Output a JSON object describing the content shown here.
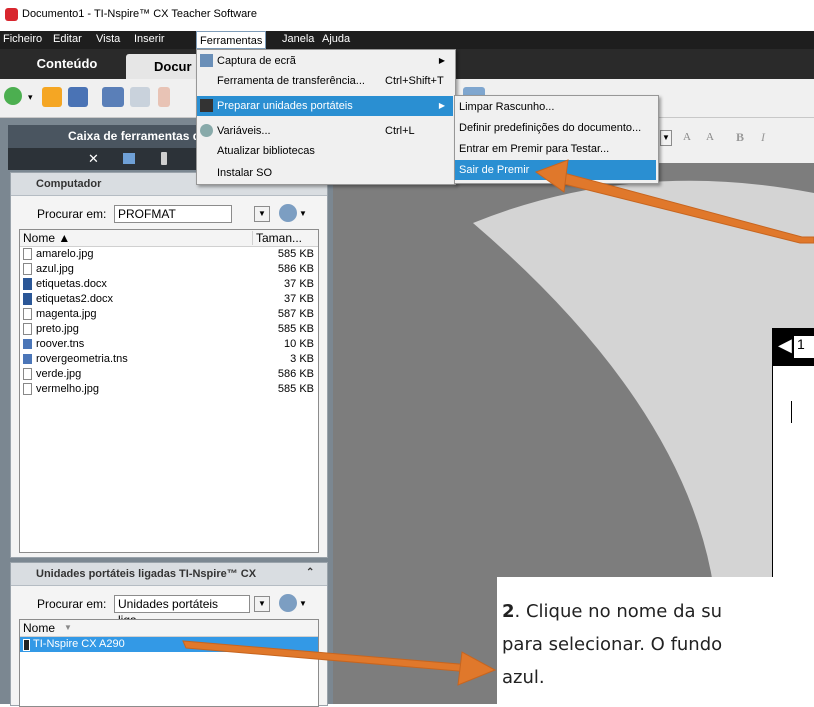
{
  "window": {
    "title": "Documento1 - TI-Nspire™ CX Teacher Software"
  },
  "menubar": [
    "Ficheiro",
    "Editar",
    "Vista",
    "Inserir",
    "Ferramentas",
    "Janela",
    "Ajuda"
  ],
  "tabs": {
    "content": "Conteúdo",
    "documents": "Docur"
  },
  "toolbox": {
    "title": "Caixa de ferramentas d"
  },
  "computer_panel": {
    "title": "Computador",
    "lookin_label": "Procurar em:",
    "lookin_value": "PROFMAT",
    "col_name": "Nome ▲",
    "col_size": "Taman...",
    "files": [
      {
        "name": "amarelo.jpg",
        "size": "585 KB",
        "icon": "image-file-icon"
      },
      {
        "name": "azul.jpg",
        "size": "586 KB",
        "icon": "image-file-icon"
      },
      {
        "name": "etiquetas.docx",
        "size": "37 KB",
        "icon": "word-file-icon"
      },
      {
        "name": "etiquetas2.docx",
        "size": "37 KB",
        "icon": "word-file-icon"
      },
      {
        "name": "magenta.jpg",
        "size": "587 KB",
        "icon": "image-file-icon"
      },
      {
        "name": "preto.jpg",
        "size": "585 KB",
        "icon": "image-file-icon"
      },
      {
        "name": "roover.tns",
        "size": "10 KB",
        "icon": "tns-file-icon"
      },
      {
        "name": "rovergeometria.tns",
        "size": "3 KB",
        "icon": "tns-file-icon"
      },
      {
        "name": "verde.jpg",
        "size": "586 KB",
        "icon": "image-file-icon"
      },
      {
        "name": "vermelho.jpg",
        "size": "585 KB",
        "icon": "image-file-icon"
      }
    ]
  },
  "devices_panel": {
    "title": "Unidades portáteis ligadas TI-Nspire™ CX",
    "lookin_label": "Procurar em:",
    "lookin_value": "Unidades portáteis liga...",
    "col_name": "Nome",
    "devices": [
      "TI-Nspire CX A290"
    ]
  },
  "ferramentas_menu": [
    {
      "label": "Captura de ecrã",
      "shortcut": "",
      "submenu": true,
      "icon": "screen-capture-icon"
    },
    {
      "label": "Ferramenta de transferência...",
      "shortcut": "Ctrl+Shift+T",
      "submenu": false,
      "icon": ""
    },
    {
      "label": "Preparar unidades portáteis",
      "shortcut": "",
      "submenu": true,
      "icon": "handheld-icon",
      "selected": true
    },
    {
      "label": "Variáveis...",
      "shortcut": "Ctrl+L",
      "submenu": false,
      "icon": "variables-icon"
    },
    {
      "label": "Atualizar bibliotecas",
      "shortcut": "",
      "submenu": false,
      "icon": ""
    },
    {
      "label": "Instalar SO",
      "shortcut": "",
      "submenu": false,
      "icon": ""
    }
  ],
  "preparar_submenu": [
    {
      "label": "Limpar Rascunho...",
      "selected": false
    },
    {
      "label": "Definir predefinições do documento...",
      "selected": false
    },
    {
      "label": "Entrar em Premir para Testar...",
      "selected": false
    },
    {
      "label": "Sair de Premir",
      "selected": true
    }
  ],
  "format_toolbar": {
    "font_up": "A",
    "font_down": "A",
    "bold": "B",
    "italic": "I"
  },
  "document": {
    "tab_label": "1"
  },
  "annotation": {
    "step": "2",
    "line1": ". Clique no nome da su",
    "line2": "para selecionar. O fundo",
    "line3": "azul."
  },
  "colors": {
    "arrow": "#e0782b",
    "selection": "#2a8fd2",
    "menubar": "#1e1e1e"
  }
}
